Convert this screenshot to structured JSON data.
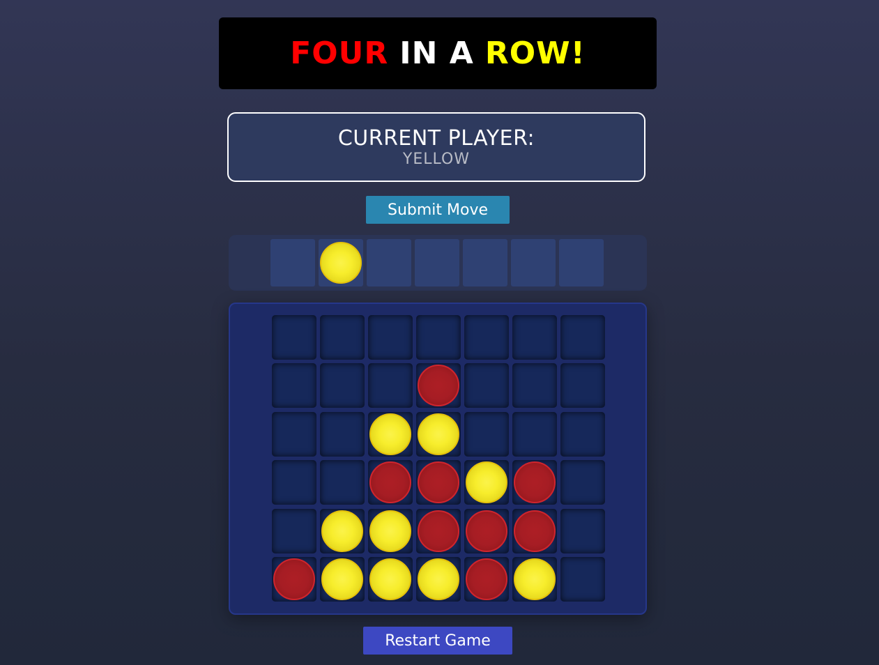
{
  "title": {
    "parts": [
      {
        "text": "FOUR",
        "color": "#ff0000"
      },
      {
        "text": "IN A",
        "color": "#ffffff"
      },
      {
        "text": "ROW!",
        "color": "#ffff00"
      }
    ]
  },
  "status": {
    "label": "CURRENT PLAYER:",
    "value": "YELLOW"
  },
  "controls": {
    "submit_label": "Submit Move",
    "restart_label": "Restart Game"
  },
  "selector": {
    "columns": 7,
    "selected_column": 1,
    "disc_color": "yellow"
  },
  "board": {
    "rows": 6,
    "cols": 7,
    "grid": [
      [
        "",
        "",
        "",
        "",
        "",
        "",
        ""
      ],
      [
        "",
        "",
        "",
        "red",
        "",
        "",
        ""
      ],
      [
        "",
        "",
        "yellow",
        "yellow",
        "",
        "",
        ""
      ],
      [
        "",
        "",
        "red",
        "red",
        "yellow",
        "red",
        ""
      ],
      [
        "",
        "yellow",
        "yellow",
        "red",
        "red",
        "red",
        ""
      ],
      [
        "red",
        "yellow",
        "yellow",
        "yellow",
        "red",
        "yellow",
        ""
      ]
    ]
  },
  "colors": {
    "red": "#a61d24",
    "yellow": "#f7ed2c",
    "submit_bg": "#2a86b0",
    "restart_bg": "#3d48c2",
    "board_bg": "#1d2a66"
  }
}
